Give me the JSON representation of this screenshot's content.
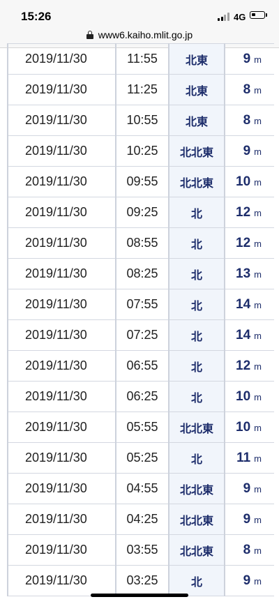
{
  "status_bar": {
    "time": "15:26",
    "network": "4G",
    "battery_level": 0.3
  },
  "browser": {
    "url": "www6.kaiho.mlit.go.jp"
  },
  "table": {
    "rows": [
      {
        "date": "2019/11/30",
        "time": "11:55",
        "direction": "北東",
        "speed": "9",
        "unit": "m"
      },
      {
        "date": "2019/11/30",
        "time": "11:25",
        "direction": "北東",
        "speed": "8",
        "unit": "m"
      },
      {
        "date": "2019/11/30",
        "time": "10:55",
        "direction": "北東",
        "speed": "8",
        "unit": "m"
      },
      {
        "date": "2019/11/30",
        "time": "10:25",
        "direction": "北北東",
        "speed": "9",
        "unit": "m"
      },
      {
        "date": "2019/11/30",
        "time": "09:55",
        "direction": "北北東",
        "speed": "10",
        "unit": "m"
      },
      {
        "date": "2019/11/30",
        "time": "09:25",
        "direction": "北",
        "speed": "12",
        "unit": "m"
      },
      {
        "date": "2019/11/30",
        "time": "08:55",
        "direction": "北",
        "speed": "12",
        "unit": "m"
      },
      {
        "date": "2019/11/30",
        "time": "08:25",
        "direction": "北",
        "speed": "13",
        "unit": "m"
      },
      {
        "date": "2019/11/30",
        "time": "07:55",
        "direction": "北",
        "speed": "14",
        "unit": "m"
      },
      {
        "date": "2019/11/30",
        "time": "07:25",
        "direction": "北",
        "speed": "14",
        "unit": "m"
      },
      {
        "date": "2019/11/30",
        "time": "06:55",
        "direction": "北",
        "speed": "12",
        "unit": "m"
      },
      {
        "date": "2019/11/30",
        "time": "06:25",
        "direction": "北",
        "speed": "10",
        "unit": "m"
      },
      {
        "date": "2019/11/30",
        "time": "05:55",
        "direction": "北北東",
        "speed": "10",
        "unit": "m"
      },
      {
        "date": "2019/11/30",
        "time": "05:25",
        "direction": "北",
        "speed": "11",
        "unit": "m"
      },
      {
        "date": "2019/11/30",
        "time": "04:55",
        "direction": "北北東",
        "speed": "9",
        "unit": "m"
      },
      {
        "date": "2019/11/30",
        "time": "04:25",
        "direction": "北北東",
        "speed": "9",
        "unit": "m"
      },
      {
        "date": "2019/11/30",
        "time": "03:55",
        "direction": "北北東",
        "speed": "8",
        "unit": "m"
      },
      {
        "date": "2019/11/30",
        "time": "03:25",
        "direction": "北",
        "speed": "9",
        "unit": "m"
      }
    ]
  }
}
